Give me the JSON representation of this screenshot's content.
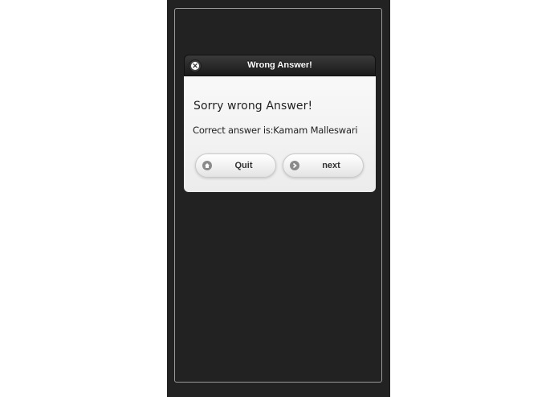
{
  "dialog": {
    "title": "Wrong Answer!",
    "close_icon": "close-icon",
    "heading": "Sorry wrong Answer!",
    "message": "Correct answer is:Kamam Malleswari",
    "buttons": {
      "quit_label": "Quit",
      "quit_icon": "home-icon",
      "next_label": "next",
      "next_icon": "arrow-right-icon"
    }
  },
  "colors": {
    "screen_bg": "#222222",
    "header_bg": "#1f1f1f",
    "body_bg": "#f4f4f4",
    "button_bg": "#f5f5f5"
  }
}
